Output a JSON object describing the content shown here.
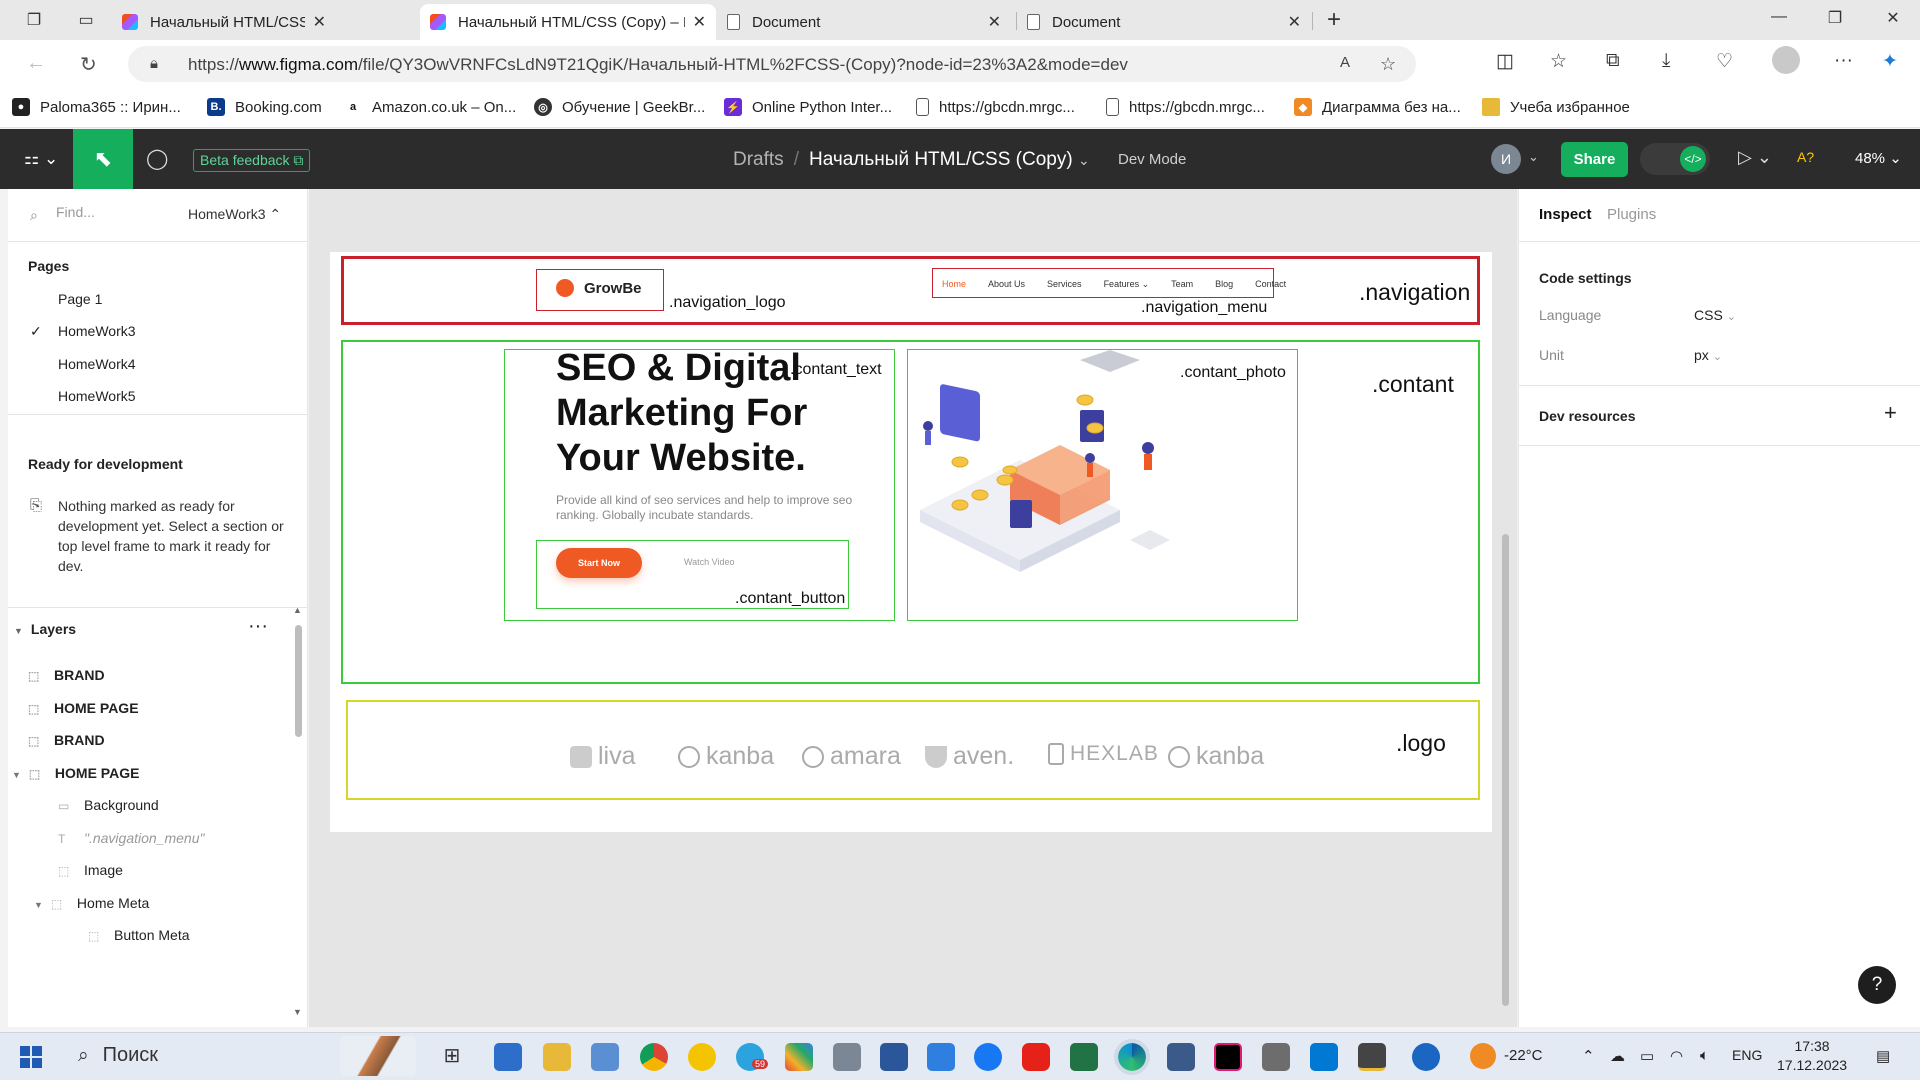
{
  "browser": {
    "tabs": [
      {
        "title": "Начальный HTML/CSS – Figma",
        "icon": "figma-icon",
        "active": false
      },
      {
        "title": "Начальный HTML/CSS (Copy) – I",
        "icon": "figma-icon",
        "active": true
      },
      {
        "title": "Document",
        "icon": "document-icon",
        "active": false
      },
      {
        "title": "Document",
        "icon": "document-icon",
        "active": false
      }
    ],
    "url_prefix": "https://",
    "url_domain": "www.figma.com",
    "url_path": "/file/QY3OwVRNFCsLdN9T21QgiK/Начальный-HTML%2FCSS-(Copy)?node-id=23%3A2&mode=dev",
    "bookmarks": [
      {
        "label": "Paloma365 :: Ирин...",
        "icon": "paloma-icon",
        "color": "#222222"
      },
      {
        "label": "Booking.com",
        "icon": "booking-icon",
        "color": "#0c3b8c"
      },
      {
        "label": "Amazon.co.uk – On...",
        "icon": "amazon-icon",
        "color": "#111111"
      },
      {
        "label": "Обучение | GeekBr...",
        "icon": "geekbrains-icon",
        "color": "#333333"
      },
      {
        "label": "Online Python Inter...",
        "icon": "python-icon",
        "color": "#6a2bd9"
      },
      {
        "label": "https://gbcdn.mrgc...",
        "icon": "page-icon",
        "color": "#ffffff"
      },
      {
        "label": "https://gbcdn.mrgc...",
        "icon": "page-icon",
        "color": "#ffffff"
      },
      {
        "label": "Диаграмма без на...",
        "icon": "diagram-icon",
        "color": "#f08a24"
      },
      {
        "label": "Учеба избранное",
        "icon": "folder-icon",
        "color": "#e8b938"
      }
    ]
  },
  "figma": {
    "beta_label": "Beta feedback",
    "breadcrumb_drafts": "Drafts",
    "breadcrumb_sep": "/",
    "file_name": "Начальный HTML/CSS (Copy)",
    "dev_mode": "Dev Mode",
    "avatar": "И",
    "share": "Share",
    "spell": "A?",
    "zoom": "48%",
    "accent": "#14ae5c"
  },
  "left_panel": {
    "search_placeholder": "Find...",
    "page_selector": "HomeWork3",
    "pages_title": "Pages",
    "pages": [
      "Page 1",
      "HomeWork3",
      "HomeWork4",
      "HomeWork5"
    ],
    "selected_page": "HomeWork3",
    "rfd_title": "Ready for development",
    "rfd_text": "Nothing marked as ready for development yet. Select a section or top level frame to mark it ready for dev.",
    "layers_title": "Layers",
    "layers": [
      {
        "name": "BRAND",
        "bold": true
      },
      {
        "name": "HOME PAGE",
        "bold": true
      },
      {
        "name": "BRAND",
        "bold": true
      },
      {
        "name": "HOME PAGE",
        "bold": true
      },
      {
        "name": "Background",
        "bold": false
      },
      {
        "name": "\".navigation_menu\"",
        "bold": false
      },
      {
        "name": "Image",
        "bold": false
      },
      {
        "name": "Home Meta",
        "bold": false
      },
      {
        "name": "Button Meta",
        "bold": false
      }
    ]
  },
  "canvas": {
    "labels": {
      "navigation": ".navigation",
      "navigation_logo": ".navigation_logo",
      "navigation_menu": ".navigation_menu",
      "contant": ".contant",
      "contant_text": ".contant_text",
      "contant_photo": ".contant_photo",
      "contant_button": ".contant_button",
      "logo": ".logo"
    },
    "site": {
      "brand": "GrowBe",
      "menu": [
        "Home",
        "About Us",
        "Services",
        "Features ⌄",
        "Team",
        "Blog",
        "Contact"
      ],
      "hero_title": "SEO & Digital Marketing For Your Website.",
      "hero_sub": "Provide all kind of seo services and help to improve seo ranking. Globally incubate standards.",
      "btn_start": "Start Now",
      "btn_video": "Watch Video",
      "partner_logos": [
        "liva",
        "kanba",
        "amara",
        "aven.",
        "HEXLAB",
        "kanba"
      ],
      "accent": "#ef5a24"
    }
  },
  "right_panel": {
    "tab_inspect": "Inspect",
    "tab_plugins": "Plugins",
    "code_settings": "Code settings",
    "language_label": "Language",
    "language_value": "CSS",
    "unit_label": "Unit",
    "unit_value": "px",
    "dev_resources": "Dev resources"
  },
  "taskbar": {
    "search": "Поиск",
    "weather": "-22°C",
    "lang": "ENG",
    "time": "17:38",
    "date": "17.12.2023",
    "telegram_badge": "59"
  }
}
